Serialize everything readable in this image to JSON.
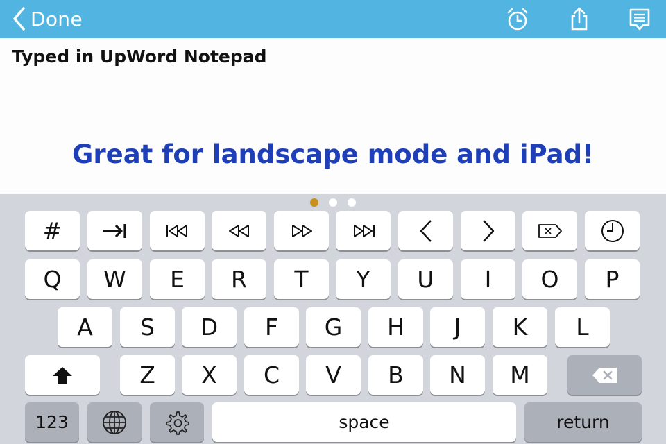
{
  "navbar": {
    "done_label": "Done",
    "icons": [
      "alarm-clock-icon",
      "share-icon",
      "notes-icon"
    ]
  },
  "document": {
    "title": "Typed in UpWord Notepad",
    "body": "Great for landscape mode and iPad!"
  },
  "keyboard": {
    "page_indicator": {
      "pages": 3,
      "current": 1
    },
    "row1_symbols": [
      {
        "id": "hash",
        "label": "#",
        "icon": "hash"
      },
      {
        "id": "tab",
        "icon": "tab-icon"
      },
      {
        "id": "first",
        "icon": "skip-to-start-icon"
      },
      {
        "id": "rewind",
        "icon": "rewind-icon"
      },
      {
        "id": "fast-forward",
        "icon": "fast-forward-icon"
      },
      {
        "id": "last",
        "icon": "skip-to-end-icon"
      },
      {
        "id": "left",
        "icon": "chevron-left-icon"
      },
      {
        "id": "right",
        "icon": "chevron-right-icon"
      },
      {
        "id": "delete-forward",
        "icon": "delete-forward-icon"
      },
      {
        "id": "time",
        "icon": "clock-icon"
      }
    ],
    "row2": [
      "Q",
      "W",
      "E",
      "R",
      "T",
      "Y",
      "U",
      "I",
      "O",
      "P"
    ],
    "row3": [
      "A",
      "S",
      "D",
      "F",
      "G",
      "H",
      "J",
      "K",
      "L"
    ],
    "row4": [
      "Z",
      "X",
      "C",
      "V",
      "B",
      "N",
      "M"
    ],
    "bottom": {
      "numbers_label": "123",
      "space_label": "space",
      "return_label": "return"
    },
    "colors": {
      "key": "#ffffff",
      "dark_key": "#acb0b8",
      "background": "#d2d5db",
      "nav": "#52b4e0",
      "body_text": "#1f3fb8",
      "active_dot": "#c8901e"
    }
  }
}
